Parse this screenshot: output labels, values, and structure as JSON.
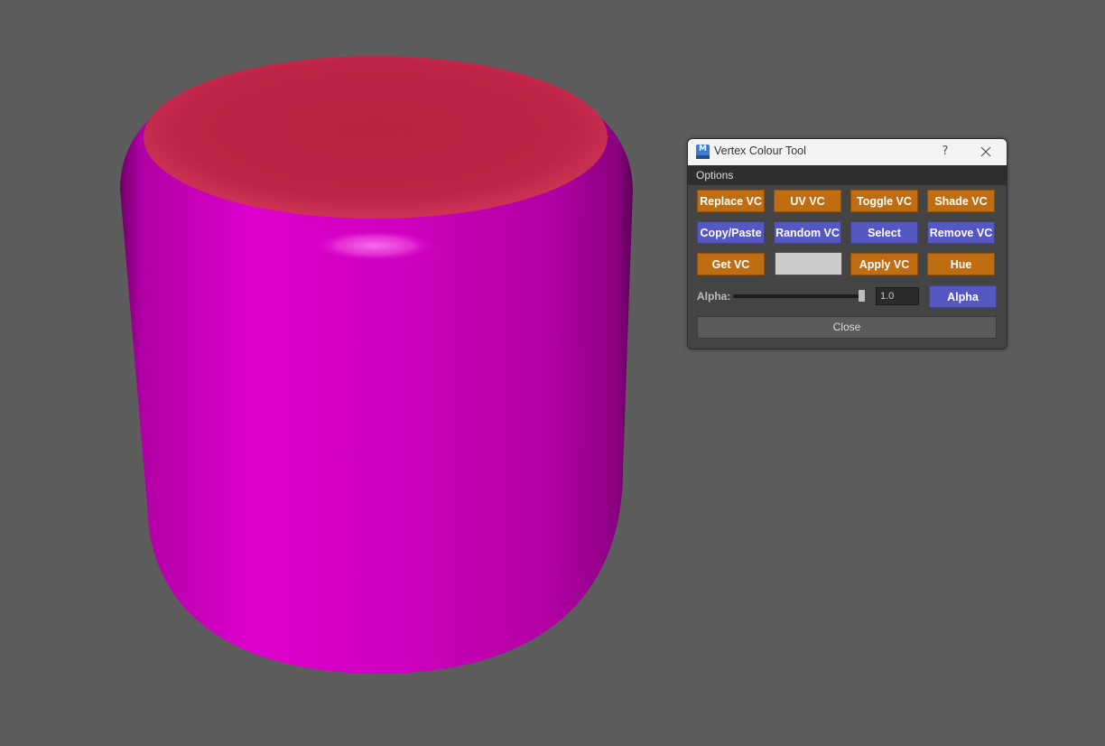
{
  "window": {
    "title": "Vertex Colour Tool",
    "app_icon_letter": "M",
    "help_symbol": "?",
    "menu_options": "Options"
  },
  "buttons": {
    "replace_vc": "Replace VC",
    "uv_vc": "UV VC",
    "toggle_vc": "Toggle VC",
    "shade_vc": "Shade VC",
    "copy_paste": "Copy/Paste",
    "random_vc": "Random VC",
    "select": "Select",
    "remove_vc": "Remove VC",
    "get_vc": "Get VC",
    "apply_vc": "Apply VC",
    "hue": "Hue",
    "alpha": "Alpha",
    "close": "Close"
  },
  "alpha": {
    "label": "Alpha:",
    "value": "1.0",
    "slider_fraction": 1.0
  },
  "colors": {
    "orange_button": "#bf6d10",
    "blue_button": "#5557c2",
    "swatch": "#cccccc",
    "cylinder_side": "#d000c0",
    "cylinder_cap": "#c12343",
    "viewport_bg": "#5d5d5d"
  },
  "icons": {
    "close": "close-icon",
    "help": "help-icon",
    "app": "maya-app-icon"
  }
}
